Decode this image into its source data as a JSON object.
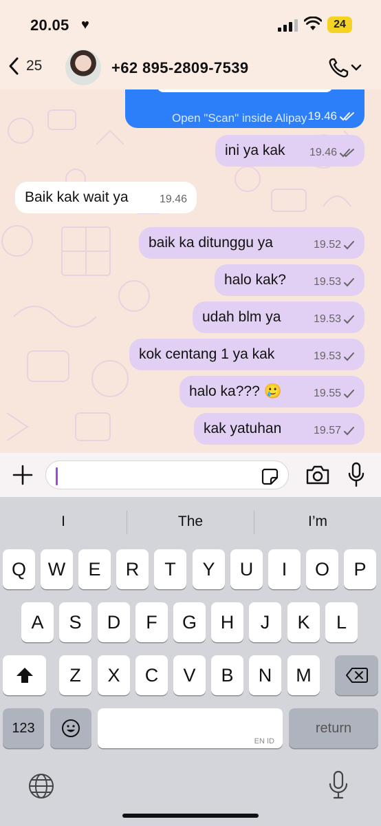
{
  "status_bar": {
    "time": "20.05",
    "battery": "24"
  },
  "header": {
    "back_count": "25",
    "contact": "+62 895-2809-7539"
  },
  "chat": {
    "partial_message": {
      "text": "Open \"Scan\" inside Alipay",
      "time": "19.46",
      "status": "read"
    },
    "messages": [
      {
        "dir": "out",
        "text": "ini ya kak",
        "time": "19.46",
        "status": "read"
      },
      {
        "dir": "in",
        "text": "Baik kak wait ya",
        "time": "19.46"
      },
      {
        "dir": "out",
        "text": "baik ka ditunggu ya",
        "time": "19.52",
        "status": "sent"
      },
      {
        "dir": "out",
        "text": "halo kak?",
        "time": "19.53",
        "status": "sent"
      },
      {
        "dir": "out",
        "text": "udah blm ya",
        "time": "19.53",
        "status": "sent"
      },
      {
        "dir": "out",
        "text": "kok centang 1 ya kak",
        "time": "19.53",
        "status": "sent"
      },
      {
        "dir": "out",
        "text": "halo ka??? 🥲",
        "time": "19.55",
        "status": "sent"
      },
      {
        "dir": "out",
        "text": "kak yatuhan",
        "time": "19.57",
        "status": "sent"
      }
    ]
  },
  "input": {
    "value": ""
  },
  "keyboard": {
    "suggestions": [
      "I",
      "The",
      "I’m"
    ],
    "rows": [
      [
        "Q",
        "W",
        "E",
        "R",
        "T",
        "Y",
        "U",
        "I",
        "O",
        "P"
      ],
      [
        "A",
        "S",
        "D",
        "F",
        "G",
        "H",
        "J",
        "K",
        "L"
      ],
      [
        "Z",
        "X",
        "C",
        "V",
        "B",
        "N",
        "M"
      ]
    ],
    "numbers_key": "123",
    "return_key": "return",
    "space_language": "EN ID"
  },
  "colors": {
    "outgoing_bubble": "#e1d0f3",
    "incoming_bubble": "#ffffff",
    "accent": "#2d7ff9"
  }
}
